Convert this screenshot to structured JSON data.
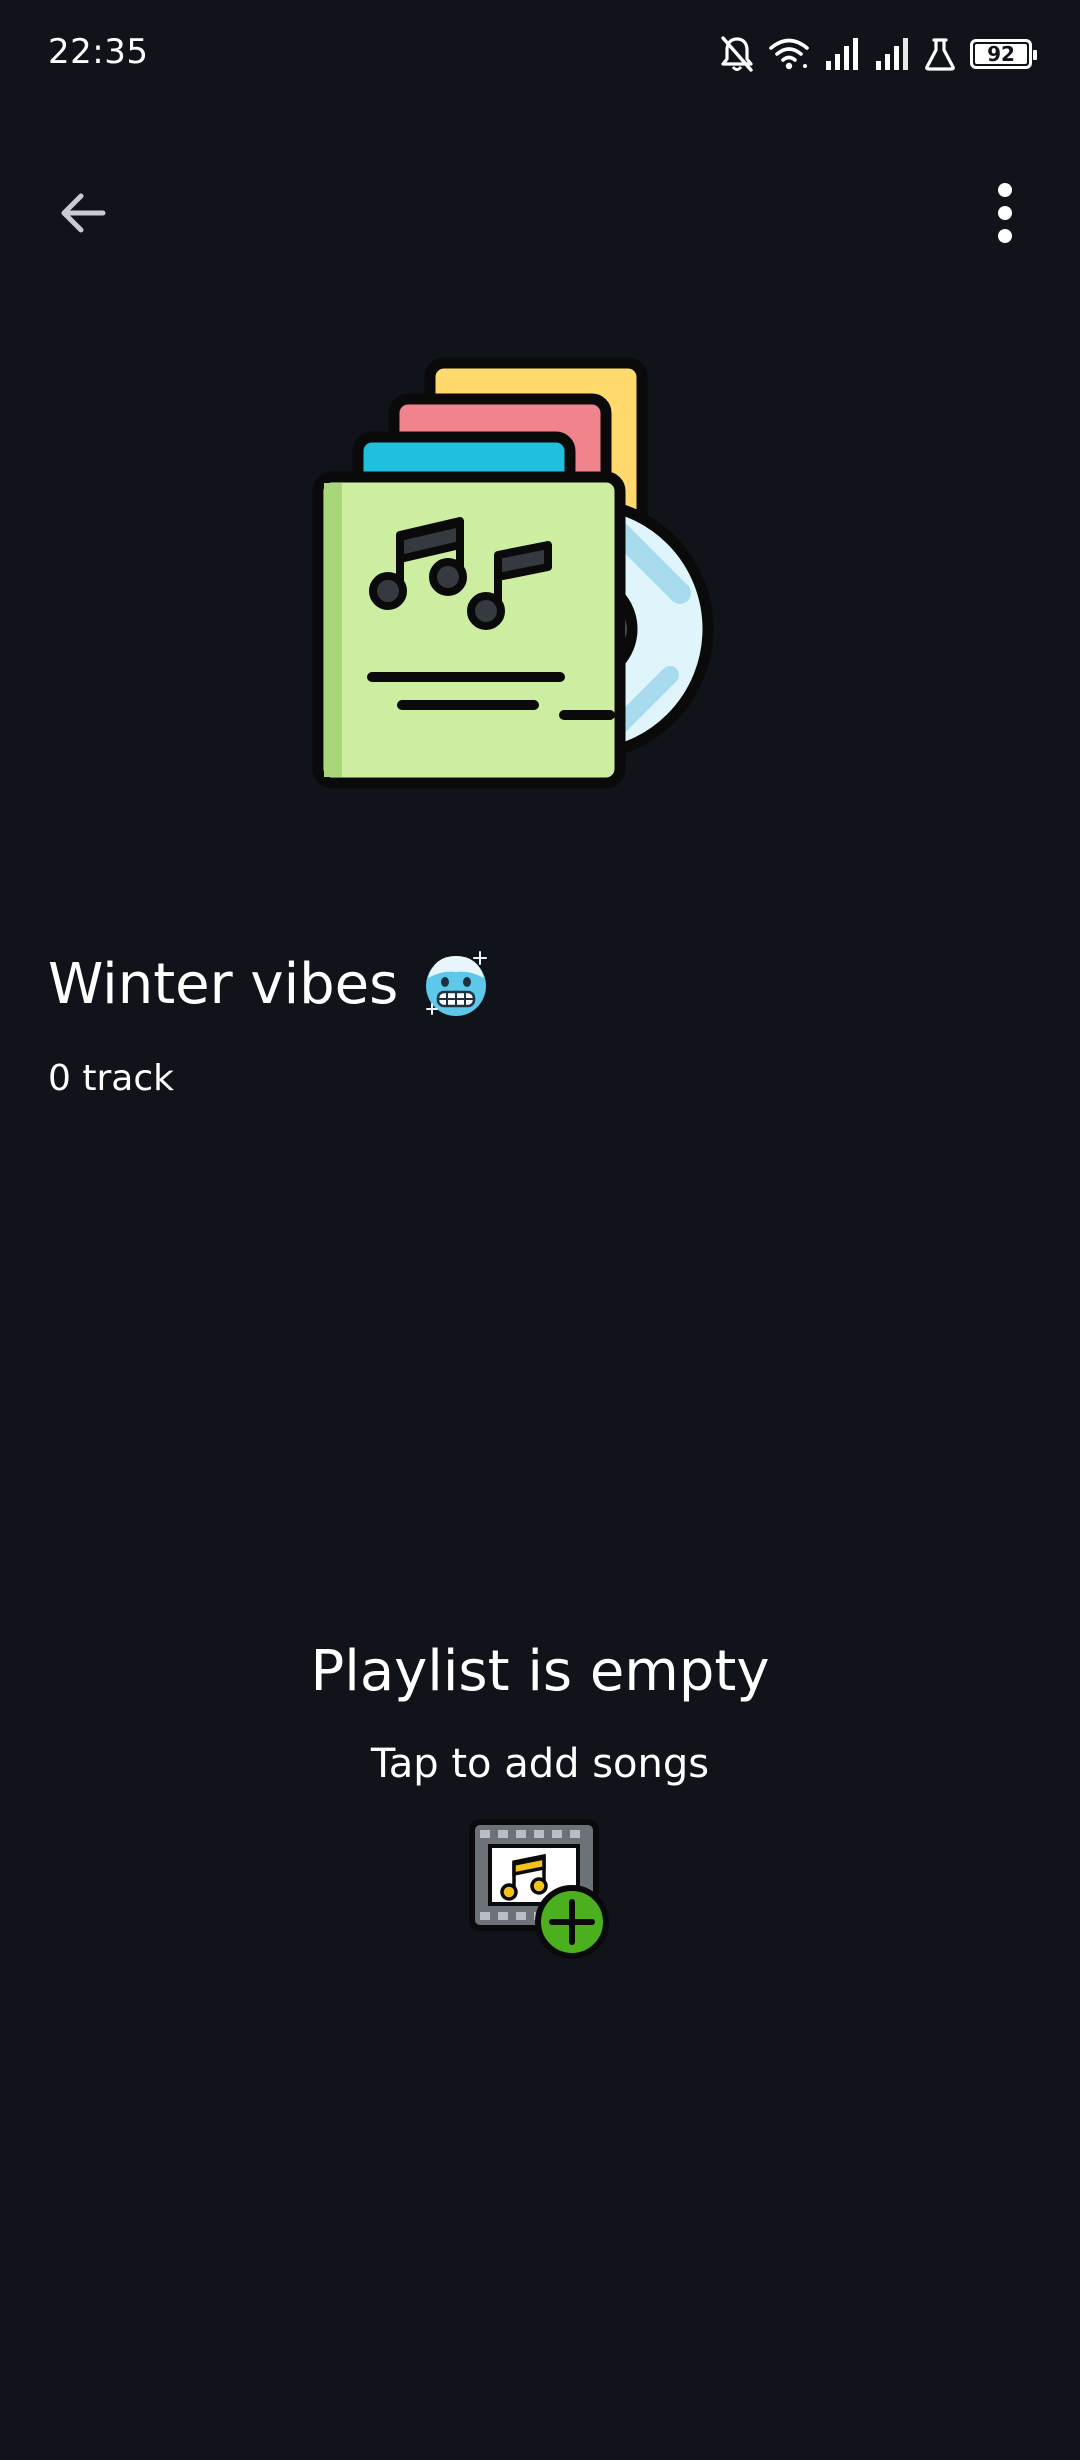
{
  "status_bar": {
    "time": "22:35",
    "battery": "92",
    "icons": [
      "bell-off-icon",
      "wifi-icon",
      "signal-icon",
      "signal-icon",
      "flask-icon",
      "battery-icon"
    ]
  },
  "toolbar": {
    "back_icon": "arrow-left-icon",
    "menu_icon": "more-vertical-icon"
  },
  "playlist": {
    "title": "Winter vibes",
    "title_emoji": "cold-face-emoji",
    "track_count": "0 track",
    "cover_icon": "album-stack-icon"
  },
  "empty_state": {
    "title": "Playlist is empty",
    "subtitle": "Tap to add songs",
    "icon": "add-music-icon"
  },
  "colors": {
    "background": "#10131a",
    "text": "#ffffff",
    "accent_green": "#4caf1e"
  }
}
